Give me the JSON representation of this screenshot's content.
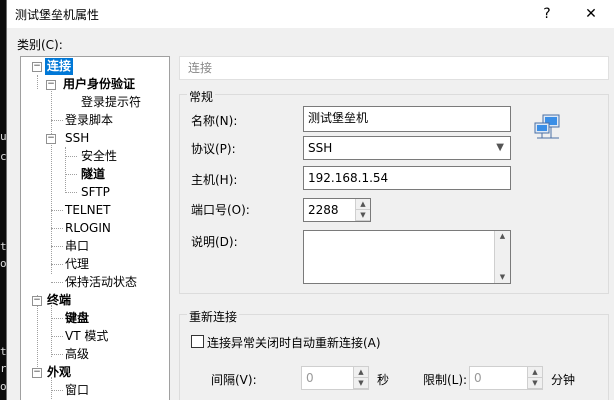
{
  "background_terminal": {
    "chars": [
      "u",
      "c",
      "t",
      "o",
      "t",
      "r",
      "o"
    ]
  },
  "window": {
    "title": "测试堡垒机属性",
    "help": "?",
    "close": "✕"
  },
  "category": {
    "label": "类别(C):"
  },
  "tree": {
    "conn": "连接",
    "auth": "用户身份验证",
    "login_prompt": "登录提示符",
    "login_script": "登录脚本",
    "ssh": "SSH",
    "security": "安全性",
    "tunnel": "隧道",
    "sftp": "SFTP",
    "telnet": "TELNET",
    "rlogin": "RLOGIN",
    "serial": "串口",
    "proxy": "代理",
    "keepalive": "保持活动状态",
    "terminal": "终端",
    "keyboard": "键盘",
    "vt": "VT 模式",
    "advanced": "高级",
    "appearance": "外观",
    "window": "窗口"
  },
  "panel": {
    "header": "连接"
  },
  "general": {
    "title": "常规",
    "name_label": "名称(N):",
    "name_value": "测试堡垒机",
    "protocol_label": "协议(P):",
    "protocol_value": "SSH",
    "host_label": "主机(H):",
    "host_value": "192.168.1.54",
    "port_label": "端口号(O):",
    "port_value": "2288",
    "desc_label": "说明(D):",
    "desc_value": ""
  },
  "reconnect": {
    "title": "重新连接",
    "checkbox_label": "连接异常关闭时自动重新连接(A)",
    "interval_label": "间隔(V):",
    "interval_value": "0",
    "interval_unit": "秒",
    "limit_label": "限制(L):",
    "limit_value": "0",
    "limit_unit": "分钟"
  }
}
